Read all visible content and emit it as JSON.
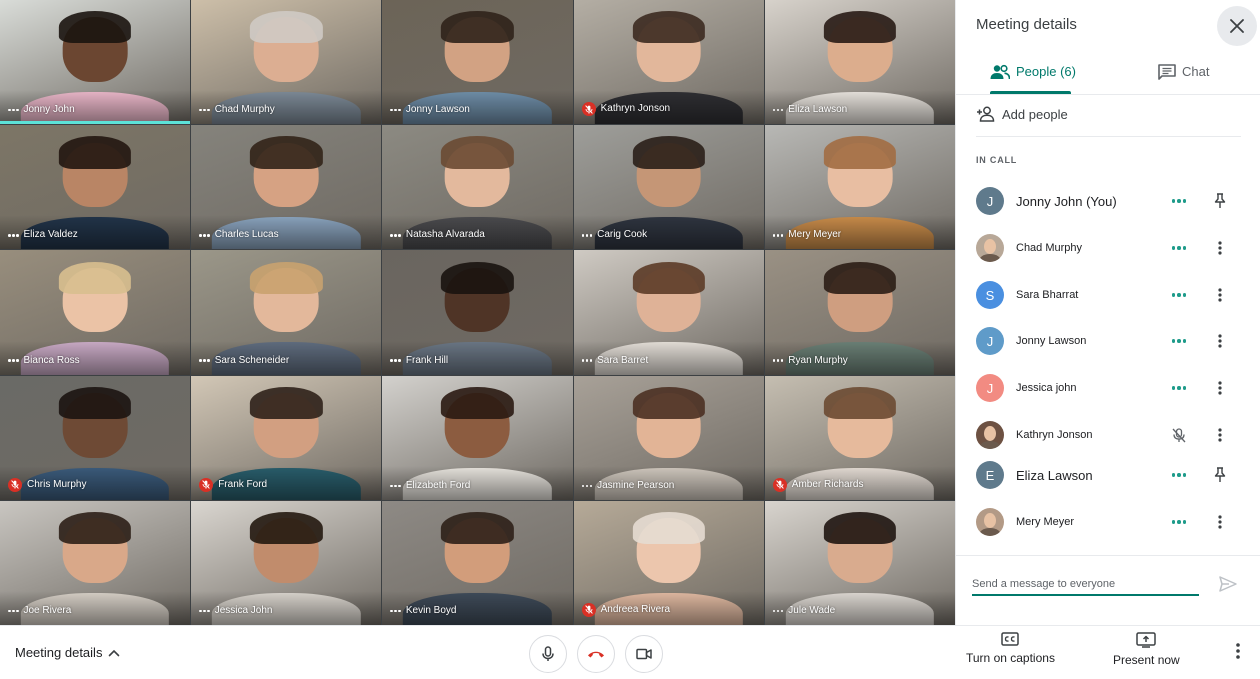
{
  "participants_grid": [
    {
      "name": "Jonny John",
      "status": "speaking",
      "skin": "#6b4631",
      "hair": "#1b1410",
      "shirt": "#e9b6c8",
      "bg": "#d9dcd8"
    },
    {
      "name": "Chad Murphy",
      "status": "dots",
      "skin": "#dcae92",
      "hair": "#cfcac4",
      "shirt": "#7d8a96",
      "bg": "#cdbfa9"
    },
    {
      "name": "Jonny Lawson",
      "status": "dots",
      "skin": "#d2a283",
      "hair": "#2f221a",
      "shirt": "#6f8ea8",
      "bg": "#6c6457"
    },
    {
      "name": "Kathryn Jonson",
      "status": "muted",
      "skin": "#e2b79b",
      "hair": "#3c2a20",
      "shirt": "#2f2f33",
      "bg": "#b4aea4"
    },
    {
      "name": "Eliza Lawson",
      "status": "dots",
      "skin": "#dcad8d",
      "hair": "#281b15",
      "shirt": "#e7e2dc",
      "bg": "#d7d2cb"
    },
    {
      "name": "Eliza Valdez",
      "status": "dots",
      "skin": "#b98565",
      "hair": "#22160f",
      "shirt": "#223449",
      "bg": "#7d7666"
    },
    {
      "name": "Charles Lucas",
      "status": "dots",
      "skin": "#d6a283",
      "hair": "#322418",
      "shirt": "#8aa3bd",
      "bg": "#85837c"
    },
    {
      "name": "Natasha Alvarada",
      "status": "dots",
      "skin": "#e3b99d",
      "hair": "#6a4a33",
      "shirt": "#4b4b4e",
      "bg": "#8c8a82"
    },
    {
      "name": "Carig Cook",
      "status": "dots",
      "skin": "#c59676",
      "hair": "#2a1f18",
      "shirt": "#2f3540",
      "bg": "#9e9e9a"
    },
    {
      "name": "Mery Meyer",
      "status": "dots",
      "skin": "#e8bea2",
      "hair": "#a26d42",
      "shirt": "#c98c4a",
      "bg": "#b8b8b5"
    },
    {
      "name": "Bianca Ross",
      "status": "dots",
      "skin": "#ebc3a6",
      "hair": "#d8bf8f",
      "shirt": "#c8a9c4",
      "bg": "#988e7d"
    },
    {
      "name": "Sara Scheneider",
      "status": "dots",
      "skin": "#e3b89b",
      "hair": "#c9a26f",
      "shirt": "#5f6c7e",
      "bg": "#9b9789"
    },
    {
      "name": "Frank Hill",
      "status": "dots",
      "skin": "#4f3426",
      "hair": "#1a1310",
      "shirt": "#6a7684",
      "bg": "#6a655f"
    },
    {
      "name": "Sara Barret",
      "status": "dots",
      "skin": "#dfb297",
      "hair": "#5c3b27",
      "shirt": "#e2ddd6",
      "bg": "#cfcac3"
    },
    {
      "name": "Ryan Murphy",
      "status": "dots",
      "skin": "#cf9e80",
      "hair": "#2b1d15",
      "shirt": "#6a7f75",
      "bg": "#9a9184"
    },
    {
      "name": "Chris Murphy",
      "status": "muted",
      "skin": "#6e4a35",
      "hair": "#1c1411",
      "shirt": "#3b5b7b",
      "bg": "#6a6a66"
    },
    {
      "name": "Frank Ford",
      "status": "muted",
      "skin": "#d29f81",
      "hair": "#2f2119",
      "shirt": "#295d6b",
      "bg": "#d2c7b6"
    },
    {
      "name": "Elizabeth Ford",
      "status": "dots",
      "skin": "#8c5c40",
      "hair": "#2a1a12",
      "shirt": "#e6e2dc",
      "bg": "#d3d1cd"
    },
    {
      "name": "Jasmine Pearson",
      "status": "dots",
      "skin": "#e2b496",
      "hair": "#4b3022",
      "shirt": "#cfc7bd",
      "bg": "#a8a198"
    },
    {
      "name": "Amber Richards",
      "status": "muted",
      "skin": "#e6ba9c",
      "hair": "#6b4a32",
      "shirt": "#e3dbd3",
      "bg": "#c5beb1"
    },
    {
      "name": "Joe Rivera",
      "status": "dots",
      "skin": "#d9a889",
      "hair": "#2c1f17",
      "shirt": "#d6cfc6",
      "bg": "#c9c6c1"
    },
    {
      "name": "Jessica John",
      "status": "dots",
      "skin": "#c18c6c",
      "hair": "#24180f",
      "shirt": "#d8d3cc",
      "bg": "#dad6d0"
    },
    {
      "name": "Kevin Boyd",
      "status": "dots",
      "skin": "#d29d7b",
      "hair": "#2e2018",
      "shirt": "#3f4b59",
      "bg": "#8e8a85"
    },
    {
      "name": "Andreea Rivera",
      "status": "muted",
      "skin": "#ecc6ad",
      "hair": "#e5dcd1",
      "shirt": "#e0b9a1",
      "bg": "#b6aa98"
    },
    {
      "name": "Jule Wade",
      "status": "dots",
      "skin": "#d9ab8e",
      "hair": "#1f1511",
      "shirt": "#ddd8d2",
      "bg": "#d8d4ce"
    }
  ],
  "panel": {
    "title": "Meeting details",
    "tabs": {
      "people": "People (6)",
      "chat": "Chat"
    },
    "add_people": "Add people",
    "in_call_label": "IN CALL",
    "message_placeholder": "Send a message to everyone"
  },
  "in_call": [
    {
      "name": "Jonny John (You)",
      "avatar_type": "initial",
      "initial": "J",
      "avatar_color": "#5f7a8c",
      "status": "dots",
      "action": "pin",
      "big": true
    },
    {
      "name": "Chad Murphy",
      "avatar_type": "photo",
      "initial": "",
      "avatar_color": "#b8a898",
      "status": "dots",
      "action": "more",
      "big": false
    },
    {
      "name": "Sara Bharrat",
      "avatar_type": "initial",
      "initial": "S",
      "avatar_color": "#4a8fe0",
      "status": "dots",
      "action": "more",
      "big": false
    },
    {
      "name": "Jonny Lawson",
      "avatar_type": "initial",
      "initial": "J",
      "avatar_color": "#5f9bc9",
      "status": "dots",
      "action": "more",
      "big": false
    },
    {
      "name": "Jessica john",
      "avatar_type": "initial",
      "initial": "J",
      "avatar_color": "#f28b82",
      "status": "dots",
      "action": "more",
      "big": false
    },
    {
      "name": "Kathryn Jonson",
      "avatar_type": "photo",
      "initial": "",
      "avatar_color": "#6d5142",
      "status": "muted",
      "action": "more",
      "big": false
    },
    {
      "name": "Eliza Lawson",
      "avatar_type": "initial",
      "initial": "E",
      "avatar_color": "#5f7a8c",
      "status": "dots",
      "action": "pin",
      "big": true
    },
    {
      "name": "Mery Meyer",
      "avatar_type": "photo",
      "initial": "",
      "avatar_color": "#b39a86",
      "status": "dots",
      "action": "more",
      "big": false
    }
  ],
  "bottom": {
    "meeting_details": "Meeting details",
    "captions": "Turn on captions",
    "present": "Present now"
  },
  "colors": {
    "accent": "#00796b",
    "dots": "#1e9b8a",
    "mute_red": "#d93025",
    "speaking": "#5ce2d8"
  }
}
